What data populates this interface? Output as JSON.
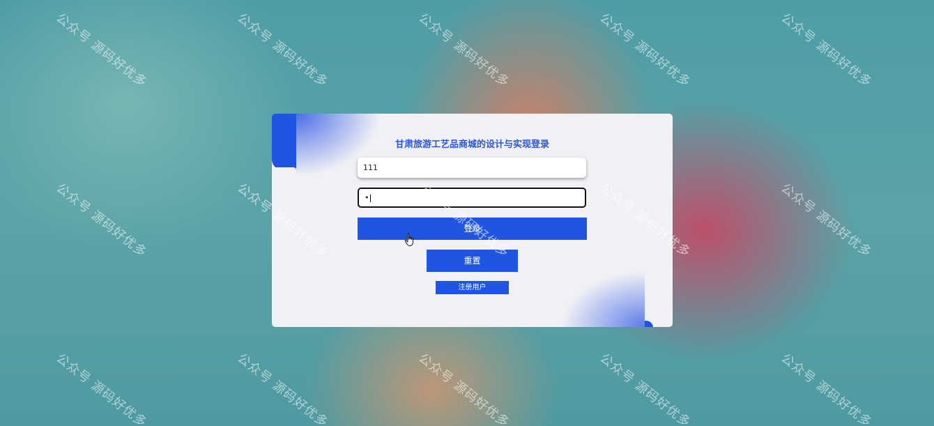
{
  "background": {
    "watermark_text": "公众号 源码好优多"
  },
  "login": {
    "title": "甘肃旅游工艺品商城的设计与实现登录",
    "username_value": "111",
    "password_value": "•",
    "login_label": "登录",
    "reset_label": "重置",
    "register_label": "注册用户"
  },
  "colors": {
    "accent": "#1f55e0",
    "title": "#2a56d6",
    "card": "#f1f1f5"
  },
  "icons": {
    "cursor": "hand-pointer-icon"
  }
}
